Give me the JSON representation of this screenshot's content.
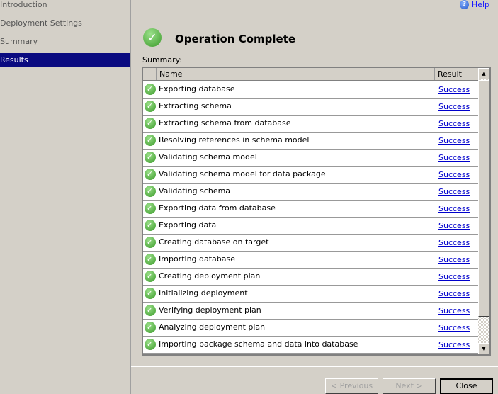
{
  "sidebar": {
    "items": [
      {
        "label": "Introduction"
      },
      {
        "label": "Deployment Settings"
      },
      {
        "label": "Summary"
      },
      {
        "label": "Results",
        "selected": true
      }
    ]
  },
  "help": {
    "label": "Help",
    "icon": "help-icon"
  },
  "header": {
    "title": "Operation Complete",
    "icon": "success-check-icon"
  },
  "summary_label": "Summary:",
  "grid": {
    "columns": [
      "Name",
      "Result"
    ],
    "rows": [
      {
        "name": "Exporting database",
        "result": "Success"
      },
      {
        "name": "Extracting schema",
        "result": "Success"
      },
      {
        "name": "Extracting schema from database",
        "result": "Success"
      },
      {
        "name": "Resolving references in schema model",
        "result": "Success"
      },
      {
        "name": "Validating schema model",
        "result": "Success"
      },
      {
        "name": "Validating schema model for data package",
        "result": "Success"
      },
      {
        "name": "Validating schema",
        "result": "Success"
      },
      {
        "name": "Exporting data from database",
        "result": "Success"
      },
      {
        "name": "Exporting data",
        "result": "Success"
      },
      {
        "name": "Creating database on target",
        "result": "Success"
      },
      {
        "name": "Importing database",
        "result": "Success"
      },
      {
        "name": "Creating deployment plan",
        "result": "Success"
      },
      {
        "name": "Initializing deployment",
        "result": "Success"
      },
      {
        "name": "Verifying deployment plan",
        "result": "Success"
      },
      {
        "name": "Analyzing deployment plan",
        "result": "Success"
      },
      {
        "name": "Importing package schema and data into database",
        "result": "Success"
      },
      {
        "name": "",
        "result": ""
      }
    ]
  },
  "buttons": {
    "previous": "< Previous",
    "next": "Next >",
    "close": "Close"
  }
}
